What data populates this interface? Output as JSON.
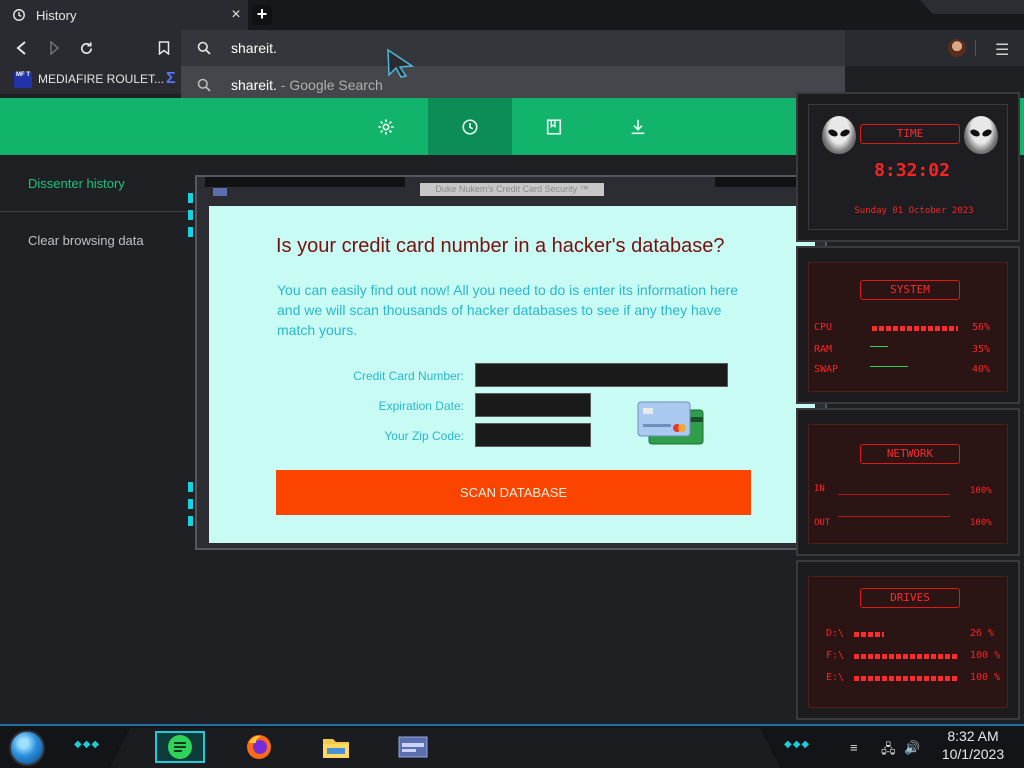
{
  "browser": {
    "tab_title": "History",
    "tab_close": "×",
    "new_tab": "+",
    "address_value": "shareit.",
    "suggestion_query": "shareit.",
    "suggestion_engine": " - Google Search",
    "bookmark_label": "MEDIAFIRE ROULET...",
    "bookmark_icon_text": "MF T",
    "menu_glyph": "☰"
  },
  "page": {
    "nav_buttons": [
      "settings-gear",
      "history-clock",
      "bookmarks-book",
      "downloads-arrow"
    ],
    "sidebar": {
      "history_label": "Dissenter history",
      "clear_label": "Clear browsing data"
    }
  },
  "popup": {
    "title": "Duke Nukem's Credit Card Security ™",
    "headline": "Is your credit card number in a hacker's database?",
    "description": "You can easily find out now! All you need to do is enter its information here and we will scan thousands of hacker databases to see if any they have match yours.",
    "fields": {
      "card_label": "Credit Card Number:",
      "exp_label": "Expiration Date:",
      "zip_label": "Your Zip Code:"
    },
    "scan_button": "SCAN DATABASE"
  },
  "gadgets": {
    "time": {
      "header": "TIME",
      "clock": "8:32:02",
      "date": "Sunday 01 October 2023"
    },
    "system": {
      "header": "SYSTEM",
      "rows": [
        {
          "label": "CPU",
          "value": "56%",
          "percent": 56
        },
        {
          "label": "RAM",
          "value": "35%",
          "percent": 35
        },
        {
          "label": "SWAP",
          "value": "40%",
          "percent": 40
        }
      ]
    },
    "network": {
      "header": "NETWORK",
      "rows": [
        {
          "label": "IN",
          "value": "100%"
        },
        {
          "label": "OUT",
          "value": "100%"
        }
      ]
    },
    "drives": {
      "header": "DRIVES",
      "rows": [
        {
          "label": "D:\\",
          "value": "26 %",
          "percent": 26
        },
        {
          "label": "F:\\",
          "value": "100 %",
          "percent": 100
        },
        {
          "label": "E:\\",
          "value": "100 %",
          "percent": 100
        }
      ]
    }
  },
  "taskbar": {
    "time": "8:32 AM",
    "date": "10/1/2023",
    "apps": [
      "notes-app",
      "firefox",
      "file-explorer",
      "media-player"
    ]
  },
  "colors": {
    "accent_green": "#12b36b",
    "popup_background": "#c7fbf3",
    "scan_button": "#fb4400",
    "headline": "#7a1010",
    "gadget_red": "#ff2222"
  }
}
